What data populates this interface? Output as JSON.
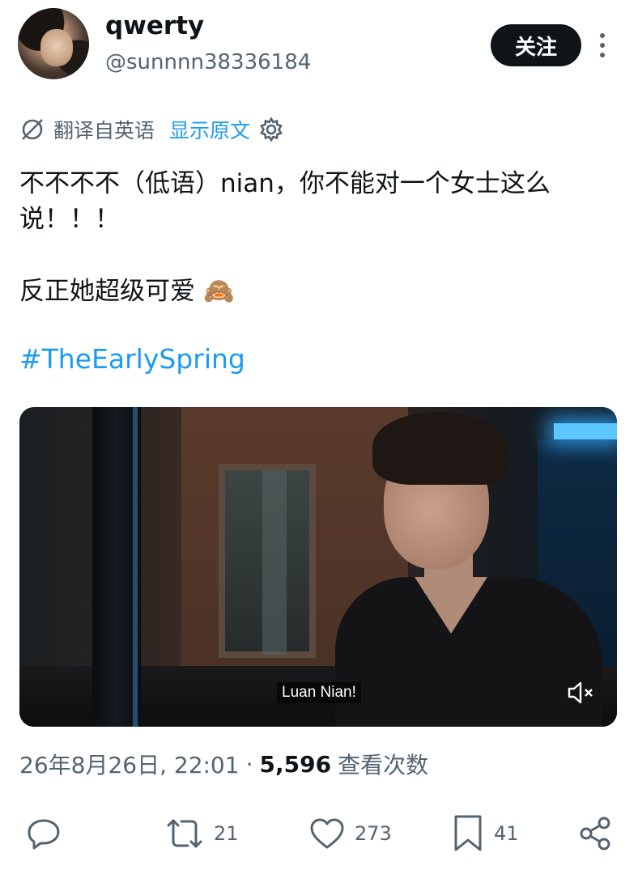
{
  "author": {
    "name": "qwerty",
    "handle": "@sunnnn38336184",
    "avatar_icon": "profile-photo"
  },
  "header": {
    "follow_label": "关注",
    "more_icon": "more-vertical-icon"
  },
  "translation": {
    "note": "翻译自英语",
    "show_original_label": "显示原文",
    "icon": "translate-icon",
    "settings_icon": "gear-icon"
  },
  "tweet": {
    "text_line1": "不不不不（低语）nian，你不能对一个女士这么说！！！",
    "text_line2": "反正她超级可爱",
    "emoji": "🙈",
    "hashtag": "#TheEarlySpring"
  },
  "video": {
    "subtitle": "Luan Nian!",
    "mute_icon": "volume-muted-icon"
  },
  "meta": {
    "timestamp": "26年8月26日, 22:01",
    "separator": "·",
    "views_count": "5,596",
    "views_label": "查看次数"
  },
  "actions": {
    "reply_count": "",
    "retweet_count": "21",
    "like_count": "273",
    "bookmark_count": "41"
  },
  "colors": {
    "accent": "#1d9bf0",
    "secondary_text": "#536471",
    "primary_text": "#0f1419"
  }
}
